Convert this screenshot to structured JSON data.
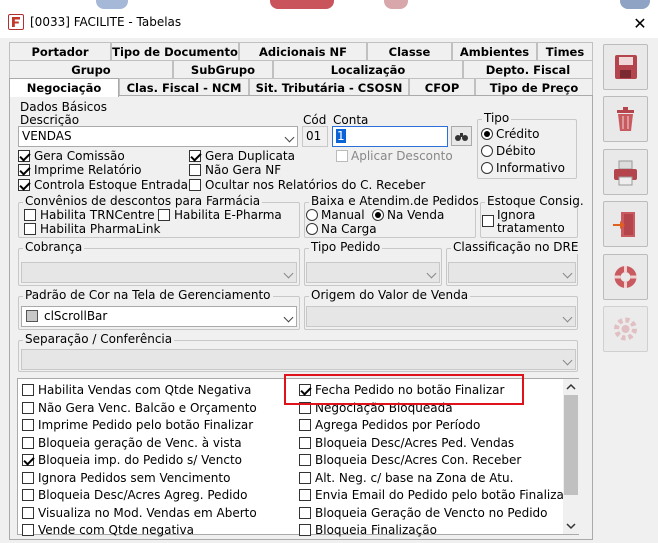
{
  "window": {
    "title": "[0033] FACILITE - Tabelas",
    "close": "✕"
  },
  "tabs_row1": [
    "Portador",
    "Tipo de Documento",
    "Adicionais NF",
    "Classe",
    "Ambientes",
    "Times"
  ],
  "tabs_row2": [
    "Grupo",
    "SubGrupo",
    "Localização",
    "Depto. Fiscal"
  ],
  "tabs_row3": [
    "Negociação",
    "Clas. Fiscal - NCM",
    "Sit. Tributária - CSOSN",
    "CFOP",
    "Tipo de Preço"
  ],
  "dados": {
    "group": "Dados Básicos",
    "desc_label": "Descrição",
    "desc_value": "VENDAS",
    "cod_label": "Cód",
    "cod_value": "01",
    "conta_label": "Conta",
    "conta_value": "1",
    "aplicar": "Aplicar Desconto"
  },
  "checks": {
    "gera_comissao": "Gera Comissão",
    "imprime_relatorio": "Imprime Relatório",
    "controla_estoque": "Controla Estoque Entrada",
    "gera_duplicata": "Gera Duplicata",
    "nao_gera_nf": "Não Gera NF",
    "ocultar": "Ocultar nos Relatórios do C. Receber"
  },
  "tipo": {
    "label": "Tipo",
    "credito": "Crédito",
    "debito": "Débito",
    "informativo": "Informativo"
  },
  "convenios": {
    "label": "Convênios de descontos para Farmácia",
    "trn": "Habilita TRNCentre",
    "epharma": "Habilita E-Pharma",
    "pharmalink": "Habilita PharmaLink"
  },
  "baixa": {
    "label": "Baixa e Atendim.de Pedidos",
    "manual": "Manual",
    "na_venda": "Na Venda",
    "na_carga": "Na Carga"
  },
  "estoque": {
    "label": "Estoque Consig.",
    "ignora1": "Ignora",
    "ignora2": "tratamento"
  },
  "cobranca": "Cobrança",
  "tipo_pedido": "Tipo Pedido",
  "classificacao": "Classificação no DRE",
  "padrao_cor": {
    "label": "Padrão de Cor na Tela de Gerenciamento",
    "value": "clScrollBar"
  },
  "origem": "Origem do Valor de Venda",
  "separacao": "Separação / Conferência",
  "list_left": [
    {
      "t": "Habilita Vendas com Qtde Negativa",
      "c": false
    },
    {
      "t": "Não Gera Venc. Balcão e Orçamento",
      "c": false
    },
    {
      "t": "Imprime Pedido pelo botão Finalizar",
      "c": false
    },
    {
      "t": "Bloqueia geração de Venc. à vista",
      "c": false
    },
    {
      "t": "Bloqueia imp. do Pedido s/ Vencto",
      "c": true
    },
    {
      "t": "Ignora Pedidos sem Vencimento",
      "c": false
    },
    {
      "t": "Bloqueia Desc/Acres Agreg. Pedido",
      "c": false
    },
    {
      "t": "Visualiza no Mod. Vendas em Aberto",
      "c": false
    },
    {
      "t": "Vende com Qtde negativa",
      "c": false
    }
  ],
  "list_right": [
    {
      "t": "Fecha Pedido no botão Finalizar",
      "c": true
    },
    {
      "t": "Negociação Bloqueada",
      "c": false
    },
    {
      "t": "Agrega Pedidos por Período",
      "c": false
    },
    {
      "t": "Bloqueia Desc/Acres Ped. Vendas",
      "c": false
    },
    {
      "t": "Bloqueia Desc/Acres Con. Receber",
      "c": false
    },
    {
      "t": "Alt. Neg. c/ base na Zona de Atu.",
      "c": false
    },
    {
      "t": "Envia Email do Pedido pelo botão Finalizar",
      "c": false
    },
    {
      "t": "Bloqueia Geração de Vencto no Pedido",
      "c": false
    },
    {
      "t": "Bloqueia Finalização",
      "c": false
    }
  ],
  "side_buttons": [
    "save-icon",
    "trash-icon",
    "printer-icon",
    "exit-door-icon",
    "lifebuoy-icon",
    "gear-icon"
  ],
  "colors": {
    "highlight": "#e0121c",
    "icon_red": "#c0392b"
  }
}
